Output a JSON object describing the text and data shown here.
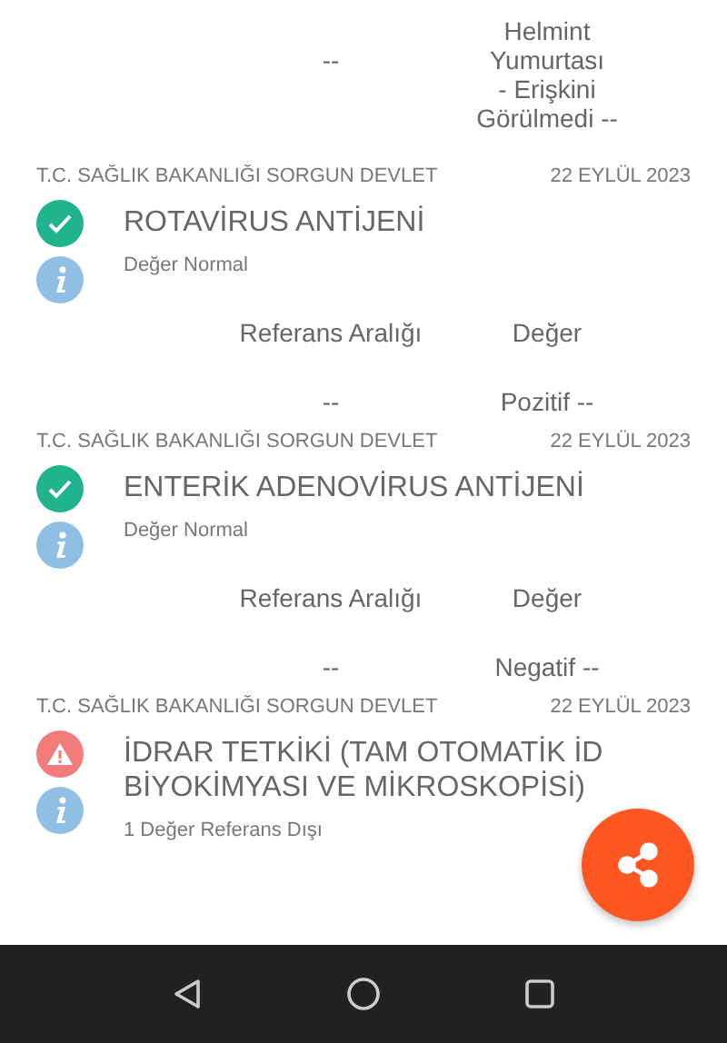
{
  "previous_result": {
    "reference": "--",
    "value_lines": [
      "Helmint",
      "Yumurtası",
      "- Erişkini",
      "Görülmedi --"
    ]
  },
  "results": [
    {
      "source": "T.C. SAĞLIK BAKANLIĞI SORGUN DEVLET",
      "date": "22 EYLÜL 2023",
      "kind": "normal",
      "title_lines": [
        "ROTAVİRUS ANTİJENİ"
      ],
      "summary": "Değer Normal",
      "table": {
        "columns": [
          "Referans Aralığı",
          "Değer"
        ],
        "row": [
          "--",
          "Pozitif --"
        ]
      }
    },
    {
      "source": "T.C. SAĞLIK BAKANLIĞI SORGUN DEVLET",
      "date": "22 EYLÜL 2023",
      "kind": "normal",
      "title_lines": [
        "ENTERİK ADENOVİRUS ANTİJENİ"
      ],
      "summary": "Değer Normal",
      "table": {
        "columns": [
          "Referans Aralığı",
          "Değer"
        ],
        "row": [
          "--",
          "Negatif --"
        ]
      }
    },
    {
      "source": "T.C. SAĞLIK BAKANLIĞI SORGUN DEVLET",
      "date": "22 EYLÜL 2023",
      "kind": "abnormal",
      "title_lines": [
        "İDRAR TETKİKİ (TAM OTOMATİK İD",
        "BİYOKİMYASI VE MİKROSKOPİSİ)"
      ],
      "summary": "1 Değer Referans Dışı"
    }
  ]
}
